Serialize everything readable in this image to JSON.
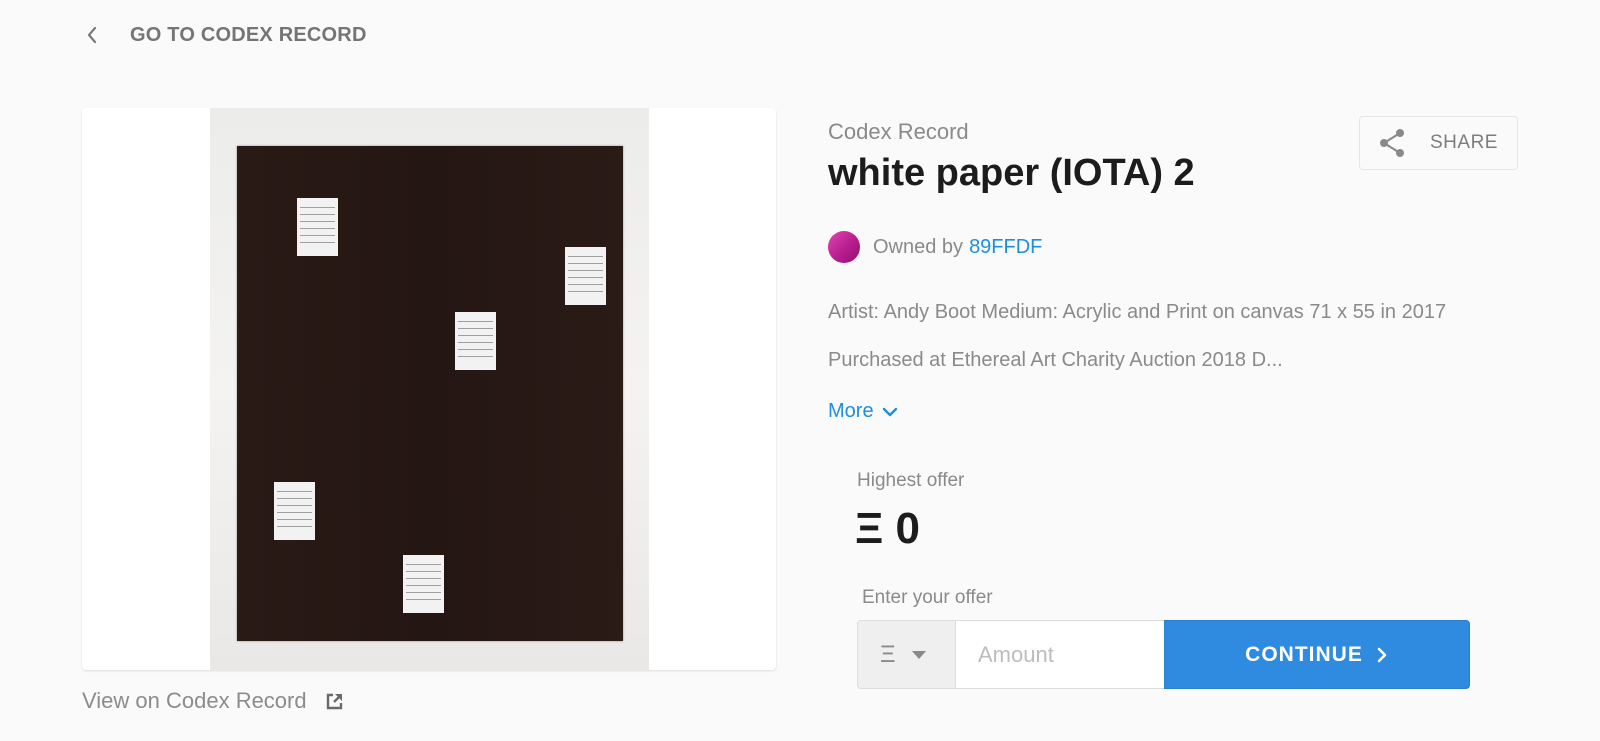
{
  "header": {
    "back_label": "GO TO CODEX RECORD",
    "back_icon": "chevron-left-icon"
  },
  "artwork": {
    "view_on_label": "View on Codex Record",
    "external_icon": "external-link-icon"
  },
  "details": {
    "eyebrow": "Codex Record",
    "title": "white paper (IOTA) 2",
    "share_label": "SHARE",
    "share_icon": "share-icon",
    "owner_prefix": "Owned by",
    "owner_name": "89FFDF",
    "owner_color": "#c42a9e",
    "description_line1": "Artist: Andy Boot Medium: Acrylic and Print on canvas 71 x 55 in 2017",
    "description_line2": "Purchased at Ethereal Art Charity Auction 2018 D...",
    "more_label": "More",
    "more_icon": "chevron-down-icon"
  },
  "offer": {
    "highest_label": "Highest offer",
    "highest_value": "Ξ 0",
    "enter_label": "Enter your offer",
    "currency_symbol": "Ξ",
    "amount_placeholder": "Amount",
    "continue_label": "CONTINUE",
    "accent_color": "#2e8be0"
  }
}
